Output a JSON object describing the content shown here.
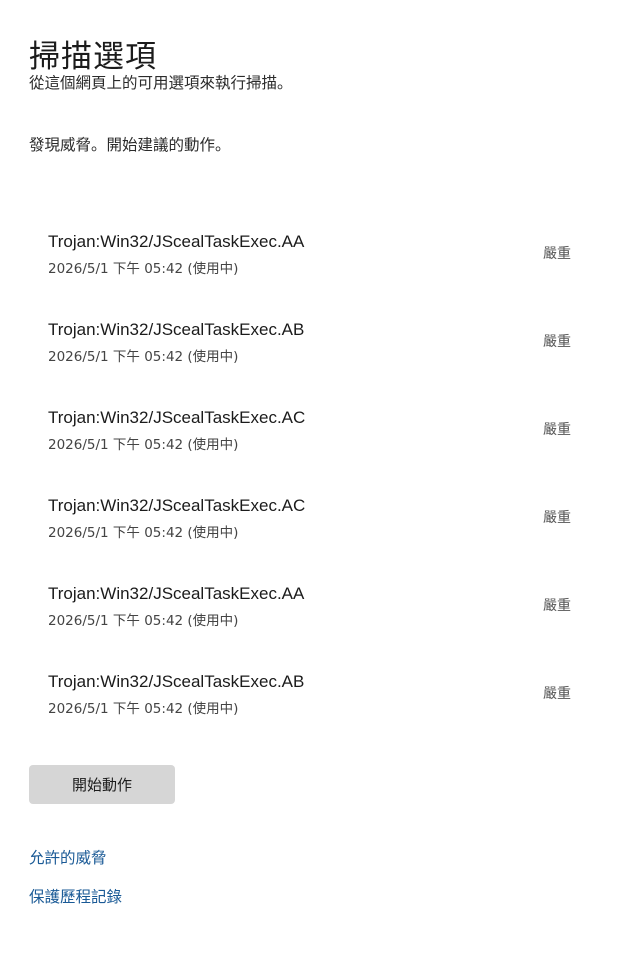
{
  "header": {
    "title": "掃描選項",
    "subtitle": "從這個網頁上的可用選項來執行掃描。",
    "status": "發現威脅。開始建議的動作。"
  },
  "threats": [
    {
      "name": "Trojan:Win32/JScealTaskExec.AA",
      "meta": "2026/5/1 下午 05:42 (使用中)",
      "severity": "嚴重"
    },
    {
      "name": "Trojan:Win32/JScealTaskExec.AB",
      "meta": "2026/5/1 下午 05:42 (使用中)",
      "severity": "嚴重"
    },
    {
      "name": "Trojan:Win32/JScealTaskExec.AC",
      "meta": "2026/5/1 下午 05:42 (使用中)",
      "severity": "嚴重"
    },
    {
      "name": "Trojan:Win32/JScealTaskExec.AC",
      "meta": "2026/5/1 下午 05:42 (使用中)",
      "severity": "嚴重"
    },
    {
      "name": "Trojan:Win32/JScealTaskExec.AA",
      "meta": "2026/5/1 下午 05:42 (使用中)",
      "severity": "嚴重"
    },
    {
      "name": "Trojan:Win32/JScealTaskExec.AB",
      "meta": "2026/5/1 下午 05:42 (使用中)",
      "severity": "嚴重"
    }
  ],
  "actions": {
    "start_label": "開始動作"
  },
  "links": {
    "allowed_threats": "允許的威脅",
    "protection_history": "保護歷程記錄"
  },
  "colors": {
    "link": "#1a5a96",
    "button_bg": "#d6d6d6",
    "text": "#1b1b1b"
  }
}
